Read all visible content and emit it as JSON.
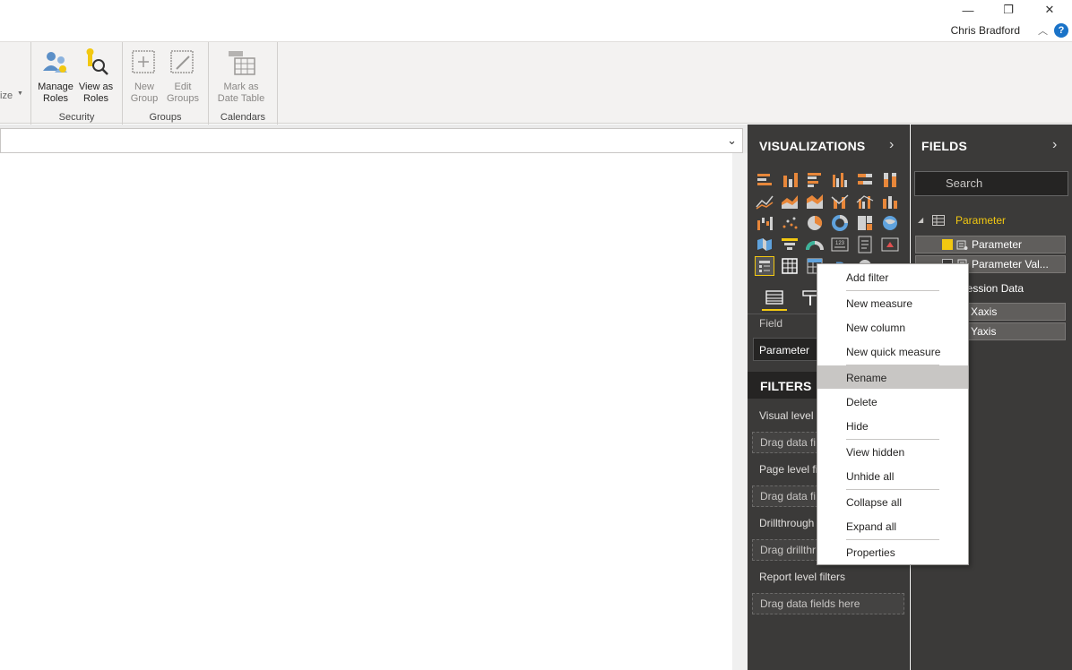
{
  "window": {
    "minimize_glyph": "—",
    "restore_glyph": "❐",
    "close_glyph": "✕",
    "user_name": "Chris Bradford",
    "help_glyph": "?"
  },
  "ribbon": {
    "partial_label": "ize",
    "groups": {
      "security": {
        "label": "Security",
        "manage_roles": "Manage Roles",
        "view_as_roles": "View as Roles"
      },
      "groups": {
        "label": "Groups",
        "new_group": "New Group",
        "edit_groups": "Edit Groups"
      },
      "calendars": {
        "label": "Calendars",
        "mark_as_date_table": "Mark as Date Table"
      }
    }
  },
  "visualizations": {
    "title": "VISUALIZATIONS",
    "field_label": "Field",
    "field_value": "Parameter"
  },
  "filters": {
    "title": "FILTERS",
    "visual_level": "Visual level f",
    "drag1": "Drag data fi",
    "page_level": "Page level fi",
    "drag2": "Drag data fi",
    "drillthrough": "Drillthrough",
    "drag3": "Drag drillthr",
    "report_level": "Report level filters",
    "drag4": "Drag data fields here"
  },
  "fields": {
    "title": "FIELDS",
    "search_placeholder": "Search",
    "tables": [
      {
        "name": "Parameter",
        "items": [
          "Parameter",
          "Parameter Val..."
        ]
      },
      {
        "name": "gression Data",
        "items": [
          "Xaxis",
          "Yaxis"
        ]
      }
    ]
  },
  "context_menu": {
    "items": [
      "Add filter",
      "New measure",
      "New column",
      "New quick measure",
      "Rename",
      "Delete",
      "Hide",
      "View hidden",
      "Unhide all",
      "Collapse all",
      "Expand all",
      "Properties"
    ],
    "hovered": "Rename"
  },
  "colors": {
    "accent": "#f2c811",
    "pane_bg": "#3b3a39",
    "ribbon_bg": "#f3f2f1",
    "viz_orange": "#e8873a",
    "viz_gray": "#d0d0d0"
  }
}
